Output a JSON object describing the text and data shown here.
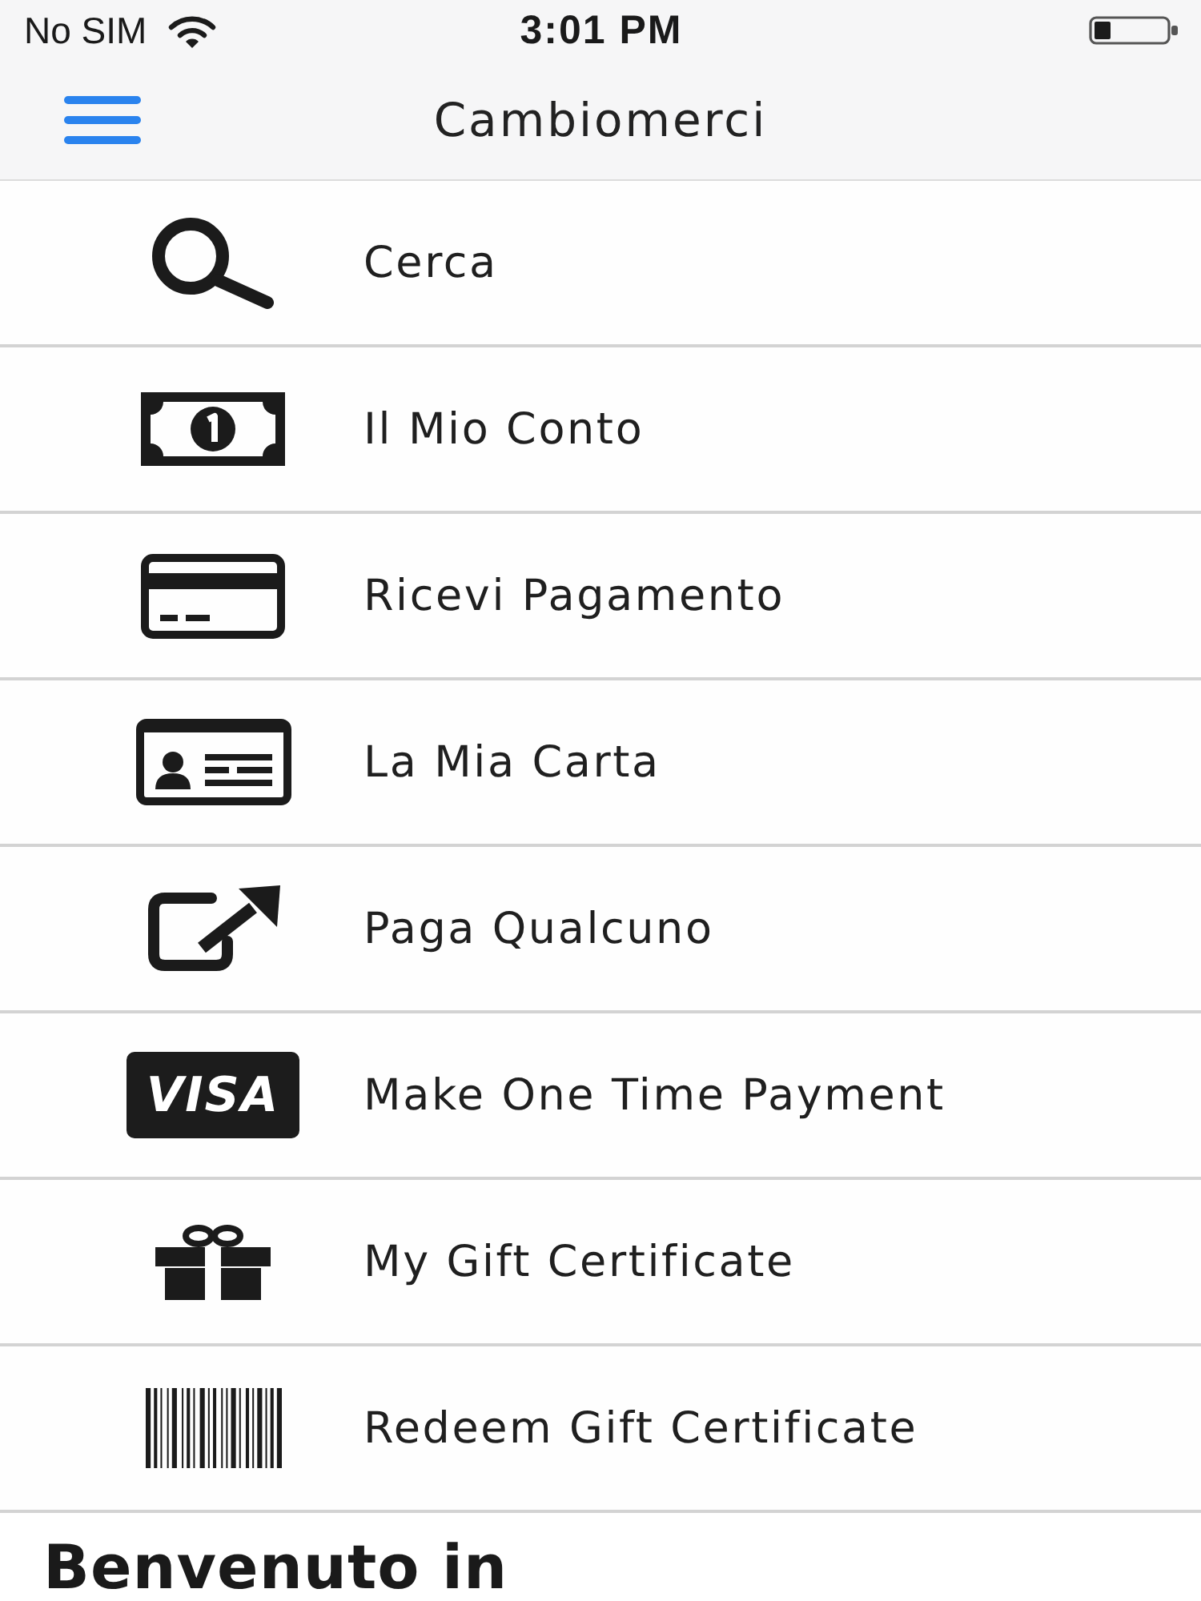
{
  "status_bar": {
    "carrier": "No SIM",
    "time": "3:01 PM"
  },
  "nav_bar": {
    "title": "Cambiomerci"
  },
  "menu": [
    {
      "kind": "search",
      "label": "Cerca"
    },
    {
      "kind": "banknote",
      "label": "Il Mio Conto"
    },
    {
      "kind": "card",
      "label": "Ricevi Pagamento"
    },
    {
      "kind": "id-card",
      "label": "La Mia Carta"
    },
    {
      "kind": "share",
      "label": "Paga Qualcuno"
    },
    {
      "kind": "logo",
      "logo_text": "VISA",
      "label": "Make One Time Payment"
    },
    {
      "kind": "gift",
      "label": "My Gift Certificate"
    },
    {
      "kind": "barcode",
      "label": "Redeem Gift Certificate"
    }
  ],
  "welcome": {
    "heading": "Benvenuto in"
  }
}
